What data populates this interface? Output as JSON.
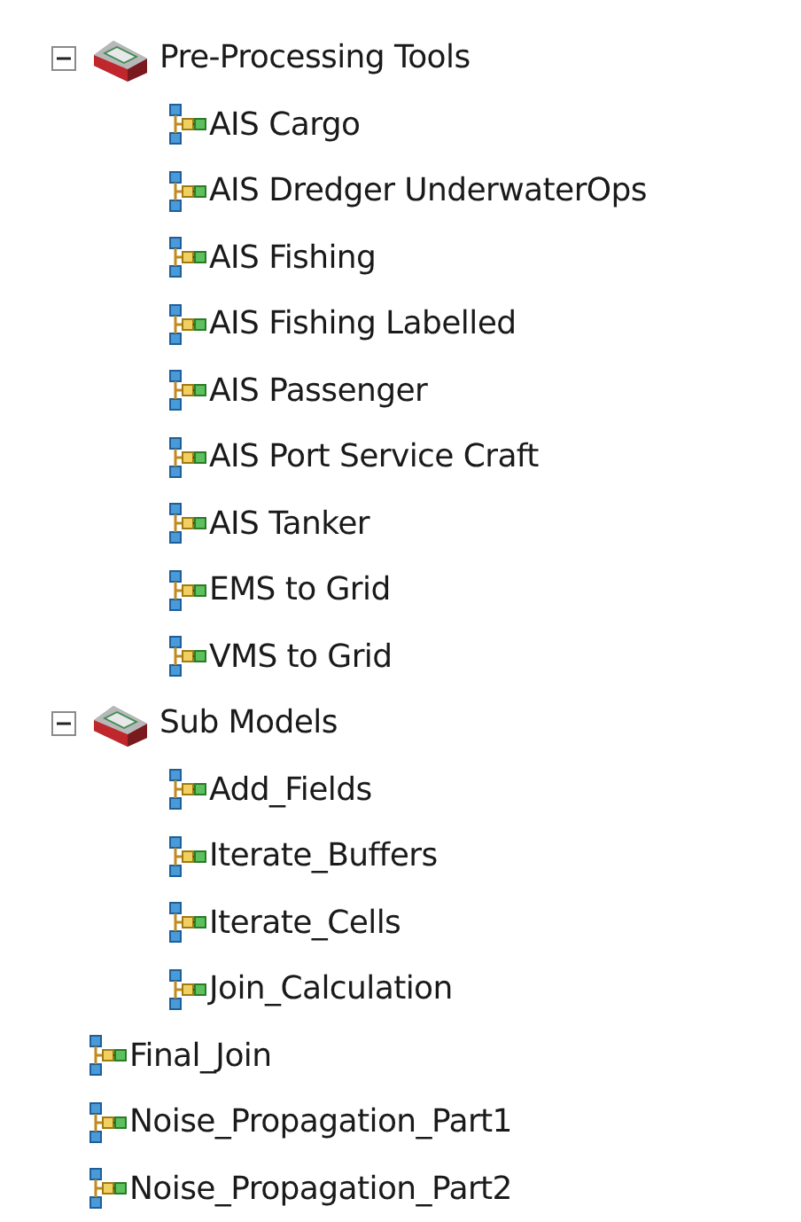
{
  "tree": [
    {
      "kind": "toolbox",
      "label": "Pre-Processing Tools",
      "expanded": true,
      "children": [
        {
          "kind": "model",
          "label": "AIS Cargo"
        },
        {
          "kind": "model",
          "label": "AIS Dredger UnderwaterOps"
        },
        {
          "kind": "model",
          "label": "AIS Fishing"
        },
        {
          "kind": "model",
          "label": "AIS Fishing Labelled"
        },
        {
          "kind": "model",
          "label": "AIS Passenger"
        },
        {
          "kind": "model",
          "label": "AIS Port Service Craft"
        },
        {
          "kind": "model",
          "label": "AIS Tanker"
        },
        {
          "kind": "model",
          "label": "EMS to Grid"
        },
        {
          "kind": "model",
          "label": "VMS to Grid"
        }
      ]
    },
    {
      "kind": "toolbox",
      "label": "Sub Models",
      "expanded": true,
      "children": [
        {
          "kind": "model",
          "label": "Add_Fields"
        },
        {
          "kind": "model",
          "label": "Iterate_Buffers"
        },
        {
          "kind": "model",
          "label": "Iterate_Cells"
        },
        {
          "kind": "model",
          "label": "Join_Calculation"
        }
      ]
    },
    {
      "kind": "model",
      "label": "Final_Join"
    },
    {
      "kind": "model",
      "label": "Noise_Propagation_Part1"
    },
    {
      "kind": "model",
      "label": "Noise_Propagation_Part2"
    }
  ]
}
